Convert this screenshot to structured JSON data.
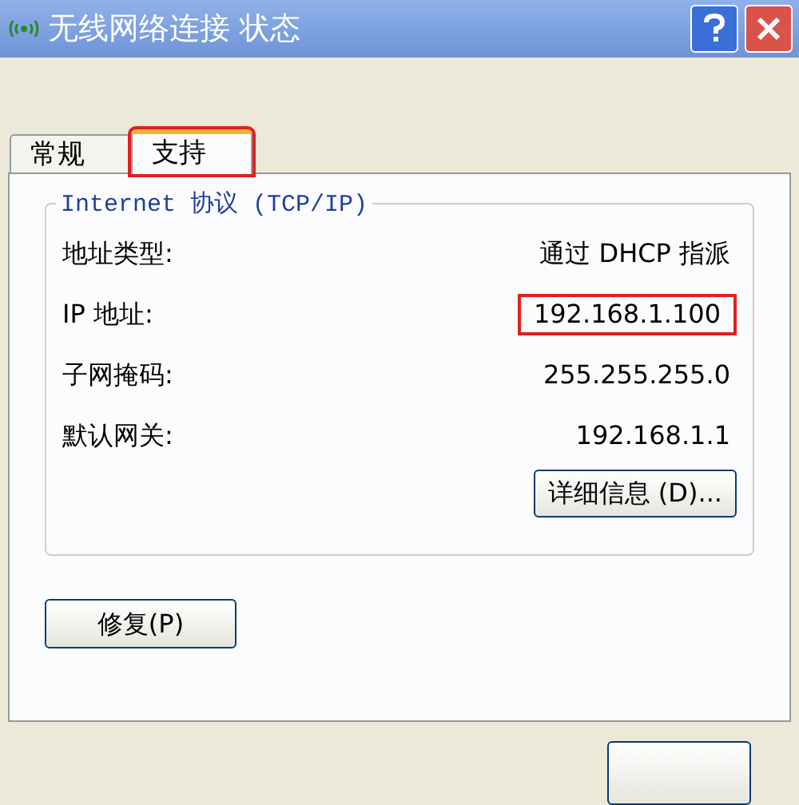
{
  "window": {
    "title": "无线网络连接 状态"
  },
  "tabs": [
    {
      "label": "常规",
      "selected": false,
      "highlighted": false
    },
    {
      "label": "支持",
      "selected": true,
      "highlighted": true
    }
  ],
  "group": {
    "title": "Internet 协议 (TCP/IP)",
    "rows": [
      {
        "label": "地址类型:",
        "value": "通过 DHCP 指派",
        "highlighted": false
      },
      {
        "label": "IP 地址:",
        "value": "192.168.1.100",
        "highlighted": true
      },
      {
        "label": "子网掩码:",
        "value": "255.255.255.0",
        "highlighted": false
      },
      {
        "label": "默认网关:",
        "value": "192.168.1.1",
        "highlighted": false
      }
    ],
    "details_button": "详细信息 (D)..."
  },
  "repair_button": "修复(P)"
}
